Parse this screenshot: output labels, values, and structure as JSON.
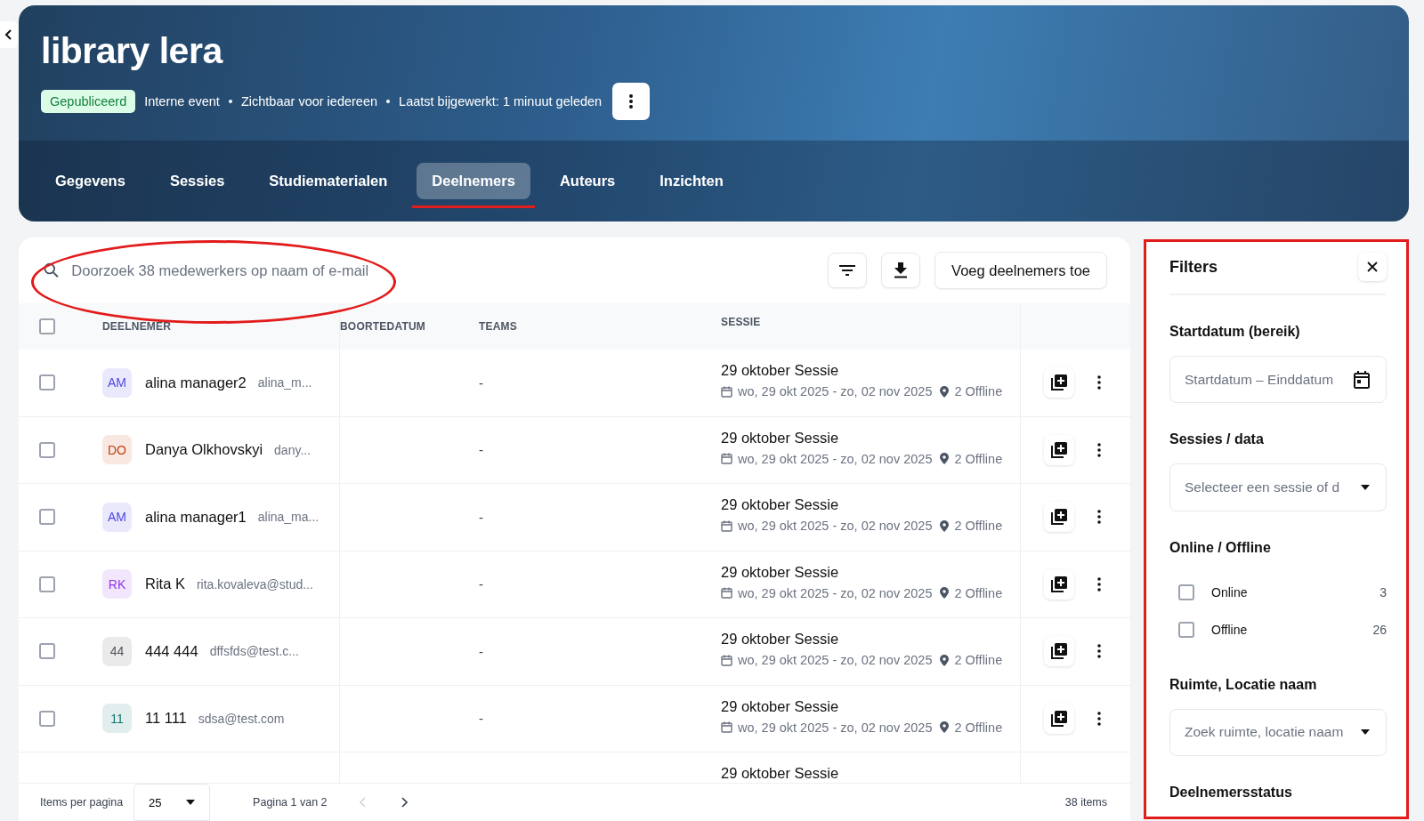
{
  "header": {
    "title": "library lera",
    "status": "Gepubliceerd",
    "meta": [
      "Interne event",
      "Zichtbaar voor iedereen",
      "Laatst bijgewerkt: 1 minuut geleden"
    ]
  },
  "tabs": [
    {
      "label": "Gegevens",
      "selected": false
    },
    {
      "label": "Sessies",
      "selected": false
    },
    {
      "label": "Studiematerialen",
      "selected": false
    },
    {
      "label": "Deelnemers",
      "selected": true
    },
    {
      "label": "Auteurs",
      "selected": false
    },
    {
      "label": "Inzichten",
      "selected": false
    }
  ],
  "toolbar": {
    "search": {
      "placeholder": "Doorzoek 38 medewerkers op naam of e-mail"
    },
    "add_button": "Voeg deelnemers toe"
  },
  "table": {
    "select_all": {
      "checked": false
    },
    "columns": [
      "DEELNEMER",
      "BOORTEDATUM",
      "TEAMS",
      "SESSIE"
    ],
    "rows": [
      {
        "checked": false,
        "initials": "AM",
        "color": "#4f46e5",
        "name": "alina manager2",
        "email": "alina_m...",
        "teams": "-",
        "session": "29 oktober Sessie",
        "dates": "wo, 29 okt 2025 - zo, 02 nov 2025",
        "location": "2 Offline"
      },
      {
        "checked": false,
        "initials": "DO",
        "color": "#c2410c",
        "name": "Danya Olkhovskyi",
        "email": "dany...",
        "teams": "-",
        "session": "29 oktober Sessie",
        "dates": "wo, 29 okt 2025 - zo, 02 nov 2025",
        "location": "2 Offline"
      },
      {
        "checked": false,
        "initials": "AM",
        "color": "#4f46e5",
        "name": "alina manager1",
        "email": "alina_ma...",
        "teams": "-",
        "session": "29 oktober Sessie",
        "dates": "wo, 29 okt 2025 - zo, 02 nov 2025",
        "location": "2 Offline"
      },
      {
        "checked": false,
        "initials": "RK",
        "color": "#9333ea",
        "name": "Rita K",
        "email": "rita.kovaleva@stud...",
        "teams": "-",
        "session": "29 oktober Sessie",
        "dates": "wo, 29 okt 2025 - zo, 02 nov 2025",
        "location": "2 Offline"
      },
      {
        "checked": false,
        "initials": "44",
        "color": "#52525b",
        "name": "444 444",
        "email": "dffsfds@test.c...",
        "teams": "-",
        "session": "29 oktober Sessie",
        "dates": "wo, 29 okt 2025 - zo, 02 nov 2025",
        "location": "2 Offline"
      },
      {
        "checked": false,
        "initials": "11",
        "color": "#0f766e",
        "name": "11 111",
        "email": "sdsa@test.com",
        "teams": "-",
        "session": "29 oktober Sessie",
        "dates": "wo, 29 okt 2025 - zo, 02 nov 2025",
        "location": "2 Offline"
      },
      {
        "session": "29 oktober Sessie"
      }
    ]
  },
  "footer": {
    "items_per_page_label": "Items per pagina",
    "items_per_page": "25",
    "page": "Pagina 1 van 2",
    "total": "38 items"
  },
  "filters": {
    "title": "Filters",
    "sections": [
      {
        "kind": "date",
        "label": "Startdatum (bereik)",
        "placeholder": "Startdatum – Einddatum"
      },
      {
        "kind": "select",
        "label": "Sessies / data",
        "placeholder": "Selecteer een sessie of d"
      },
      {
        "kind": "checkboxes",
        "label": "Online / Offline",
        "options": [
          {
            "label": "Online",
            "count": "3",
            "checked": false
          },
          {
            "label": "Offline",
            "count": "26",
            "checked": false
          }
        ]
      },
      {
        "kind": "select",
        "label": "Ruimte, Locatie naam",
        "placeholder": "Zoek ruimte, locatie naam"
      },
      {
        "kind": "heading",
        "label": "Deelnemersstatus"
      }
    ]
  }
}
